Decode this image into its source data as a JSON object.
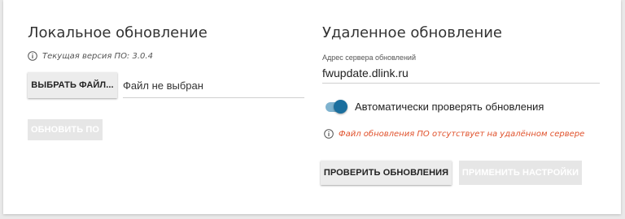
{
  "local_update": {
    "title": "Локальное обновление",
    "version_info": "Текущая версия ПО: 3.0.4",
    "select_file_label": "ВЫБРАТЬ ФАЙЛ...",
    "file_status": "Файл не выбран",
    "update_button_label": "ОБНОВИТЬ ПО"
  },
  "remote_update": {
    "title": "Удаленное обновление",
    "server_address_label": "Адрес сервера обновлений",
    "server_address_value": "fwupdate.dlink.ru",
    "auto_check_label": "Автоматически проверять обновления",
    "auto_check_enabled": true,
    "warning_text": "Файл обновления ПО отсутствует на удалённом сервере",
    "check_updates_label": "ПРОВЕРИТЬ ОБНОВЛЕНИЯ",
    "apply_settings_label": "ПРИМЕНИТЬ НАСТРОЙКИ"
  },
  "colors": {
    "accent": "#1b6f9e",
    "toggle_track": "#7fb3cf",
    "warning": "#e0512b",
    "disabled_button": "#e6e6e6"
  },
  "icons": {
    "info": "info-circle-icon"
  }
}
